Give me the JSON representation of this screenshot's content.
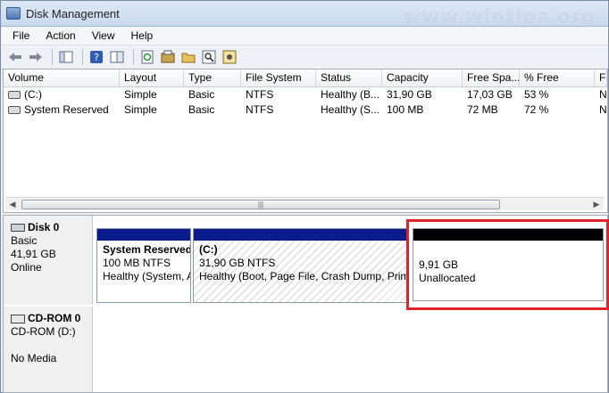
{
  "window": {
    "title": "Disk Management",
    "watermark": "www.wintips.org"
  },
  "menu": [
    "File",
    "Action",
    "View",
    "Help"
  ],
  "toolbar_icons": [
    "back-arrow-icon",
    "forward-arrow-icon",
    "console-tree-icon",
    "help-icon",
    "properties-icon",
    "refresh-icon",
    "rescan-icon",
    "folder-icon",
    "search-icon",
    "settings-icon"
  ],
  "volume_list": {
    "columns": [
      "Volume",
      "Layout",
      "Type",
      "File System",
      "Status",
      "Capacity",
      "Free Spa...",
      "% Free",
      "Fa"
    ],
    "rows": [
      [
        "(C:)",
        "Simple",
        "Basic",
        "NTFS",
        "Healthy (B...",
        "31,90 GB",
        "17,03 GB",
        "53 %",
        "N"
      ],
      [
        "System Reserved",
        "Simple",
        "Basic",
        "NTFS",
        "Healthy (S...",
        "100 MB",
        "72 MB",
        "72 %",
        "N"
      ]
    ]
  },
  "disks": [
    {
      "name": "Disk 0",
      "type": "Basic",
      "size": "41,91 GB",
      "status": "Online",
      "partitions": [
        {
          "name": "System Reserved",
          "size": "100 MB NTFS",
          "status": "Healthy (System, Active, Primary Partition)",
          "bar_color": "#0a1c8c"
        },
        {
          "name": "(C:)",
          "size": "31,90 GB NTFS",
          "status": "Healthy (Boot, Page File, Crash Dump, Primary Partition)",
          "bar_color": "#0a1c8c"
        },
        {
          "name": "",
          "size": "9,91 GB",
          "status": "Unallocated",
          "bar_color": "#000000"
        }
      ]
    },
    {
      "name": "CD-ROM 0",
      "type": "CD-ROM (D:)",
      "status": "No Media"
    }
  ],
  "highlight_color": "#e0222a"
}
